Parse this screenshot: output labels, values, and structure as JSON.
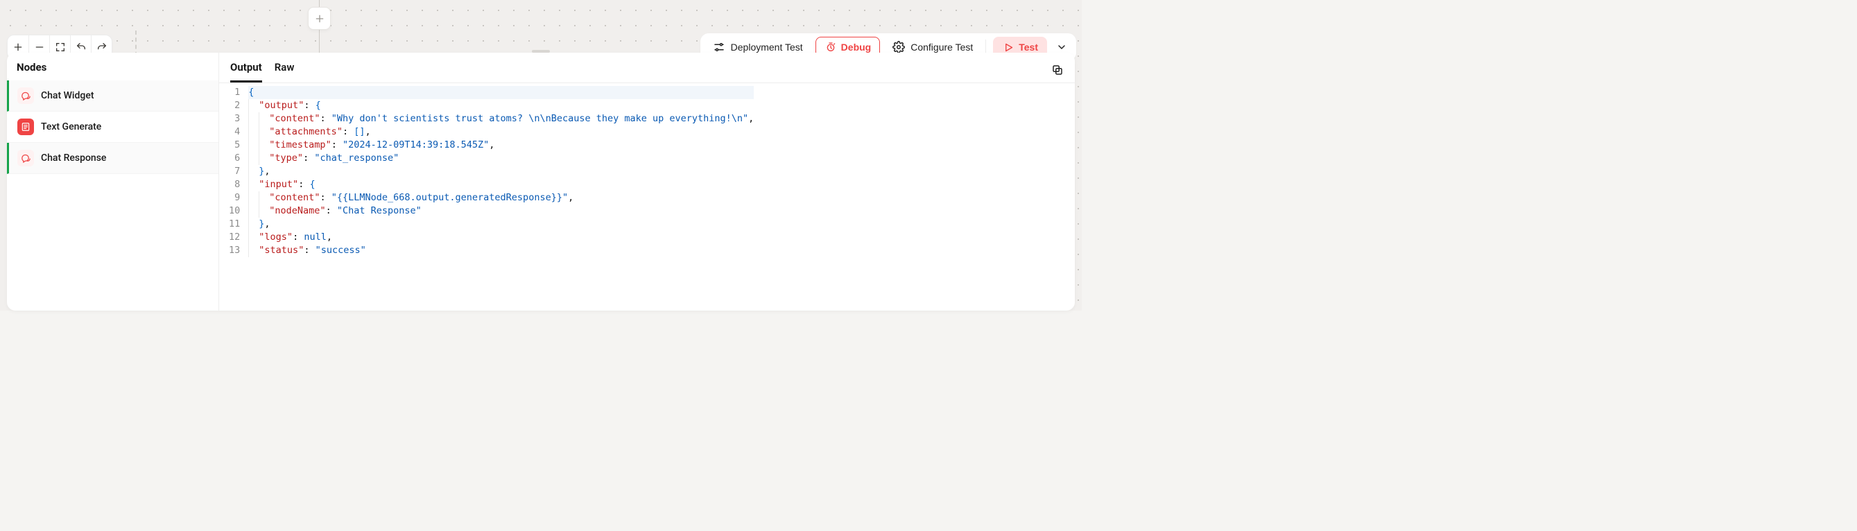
{
  "toolbar": {
    "deployment_test_label": "Deployment Test",
    "debug_label": "Debug",
    "configure_label": "Configure Test",
    "test_label": "Test"
  },
  "sidebar": {
    "title": "Nodes",
    "items": [
      {
        "label": "Chat Widget",
        "icon": "chat-bubbles-icon",
        "style": "pale",
        "selected": true
      },
      {
        "label": "Text Generate",
        "icon": "text-generate-icon",
        "style": "solid",
        "selected": false
      },
      {
        "label": "Chat Response",
        "icon": "chat-bubbles-icon",
        "style": "pale",
        "selected": true
      }
    ]
  },
  "tabs": {
    "output": "Output",
    "raw": "Raw",
    "active": "output"
  },
  "code": {
    "line_count": 13,
    "tokens": [
      [
        [
          "p",
          "{"
        ]
      ],
      [
        [
          "g",
          1
        ],
        [
          "q",
          "\""
        ],
        [
          "k",
          "output"
        ],
        [
          "q",
          "\""
        ],
        [
          "c",
          ": "
        ],
        [
          "p",
          "{"
        ]
      ],
      [
        [
          "g",
          2
        ],
        [
          "q",
          "\""
        ],
        [
          "k",
          "content"
        ],
        [
          "q",
          "\""
        ],
        [
          "c",
          ": "
        ],
        [
          "s",
          "\"Why don't scientists trust atoms? \\n\\nBecause they make up everything!\\n\""
        ],
        [
          "c",
          ","
        ]
      ],
      [
        [
          "g",
          2
        ],
        [
          "q",
          "\""
        ],
        [
          "k",
          "attachments"
        ],
        [
          "q",
          "\""
        ],
        [
          "c",
          ": "
        ],
        [
          "p",
          "[]"
        ],
        [
          "c",
          ","
        ]
      ],
      [
        [
          "g",
          2
        ],
        [
          "q",
          "\""
        ],
        [
          "k",
          "timestamp"
        ],
        [
          "q",
          "\""
        ],
        [
          "c",
          ": "
        ],
        [
          "s",
          "\"2024-12-09T14:39:18.545Z\""
        ],
        [
          "c",
          ","
        ]
      ],
      [
        [
          "g",
          2
        ],
        [
          "q",
          "\""
        ],
        [
          "k",
          "type"
        ],
        [
          "q",
          "\""
        ],
        [
          "c",
          ": "
        ],
        [
          "s",
          "\"chat_response\""
        ]
      ],
      [
        [
          "g",
          1
        ],
        [
          "p",
          "}"
        ],
        [
          "c",
          ","
        ]
      ],
      [
        [
          "g",
          1
        ],
        [
          "q",
          "\""
        ],
        [
          "k",
          "input"
        ],
        [
          "q",
          "\""
        ],
        [
          "c",
          ": "
        ],
        [
          "p",
          "{"
        ]
      ],
      [
        [
          "g",
          2
        ],
        [
          "q",
          "\""
        ],
        [
          "k",
          "content"
        ],
        [
          "q",
          "\""
        ],
        [
          "c",
          ": "
        ],
        [
          "s",
          "\"{{LLMNode_668.output.generatedResponse}}\""
        ],
        [
          "c",
          ","
        ]
      ],
      [
        [
          "g",
          2
        ],
        [
          "q",
          "\""
        ],
        [
          "k",
          "nodeName"
        ],
        [
          "q",
          "\""
        ],
        [
          "c",
          ": "
        ],
        [
          "s",
          "\"Chat Response\""
        ]
      ],
      [
        [
          "g",
          1
        ],
        [
          "p",
          "}"
        ],
        [
          "c",
          ","
        ]
      ],
      [
        [
          "g",
          1
        ],
        [
          "q",
          "\""
        ],
        [
          "k",
          "logs"
        ],
        [
          "q",
          "\""
        ],
        [
          "c",
          ": "
        ],
        [
          "n",
          "null"
        ],
        [
          "c",
          ","
        ]
      ],
      [
        [
          "g",
          1
        ],
        [
          "q",
          "\""
        ],
        [
          "k",
          "status"
        ],
        [
          "q",
          "\""
        ],
        [
          "c",
          ": "
        ],
        [
          "s",
          "\"success\""
        ]
      ]
    ]
  }
}
